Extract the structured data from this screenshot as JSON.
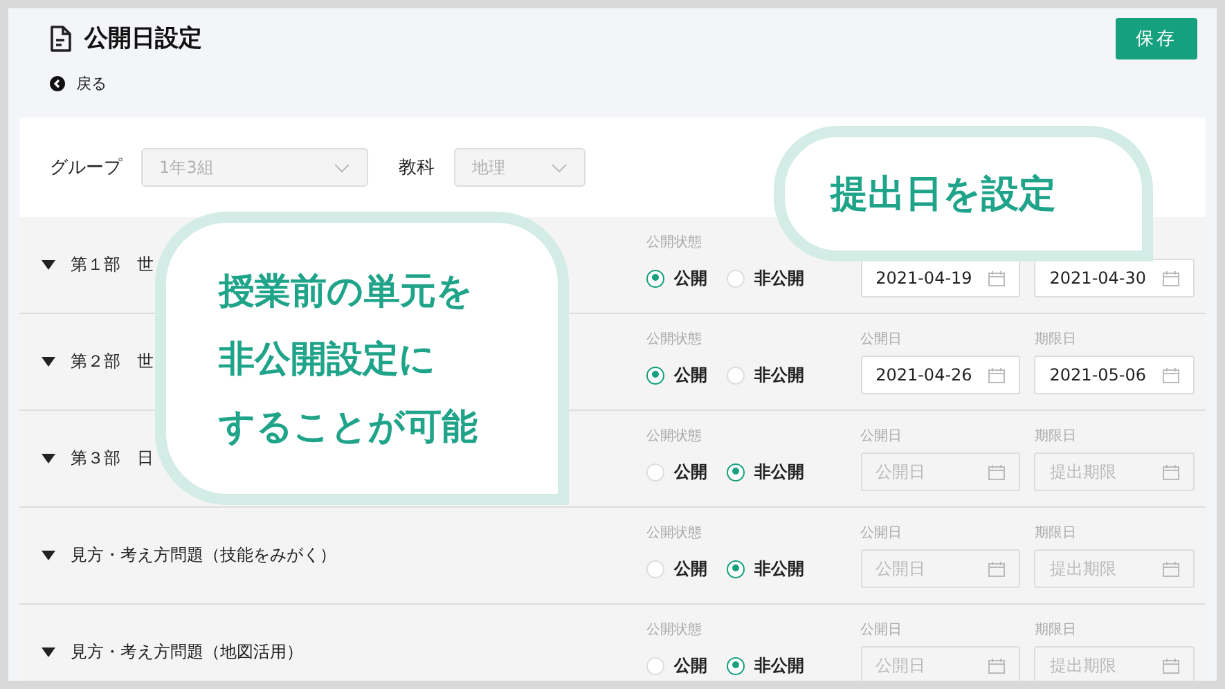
{
  "header": {
    "title": "公開日設定",
    "back": "戻る",
    "save_button": "保存"
  },
  "filters": [
    {
      "label": "グループ",
      "value": "1年3組",
      "disabled": true
    },
    {
      "label": "教科",
      "value": "地理",
      "disabled": true
    }
  ],
  "rows": [
    {
      "title": "第１部　世",
      "status_label": "公開状態",
      "options": [
        {
          "label": "公開",
          "selected": true
        },
        {
          "label": "非公開",
          "selected": false
        }
      ],
      "dates": [
        {
          "value": "2021-04-19"
        },
        {
          "value": "2021-04-30"
        }
      ]
    },
    {
      "title": "第２部　世",
      "status_label": "公開状態",
      "options": [
        {
          "label": "公開",
          "selected": true
        },
        {
          "label": "非公開",
          "selected": false
        }
      ],
      "dates": [
        {
          "label": "公開日",
          "value": "2021-04-26"
        },
        {
          "label": "期限日",
          "value": "2021-05-06"
        }
      ]
    },
    {
      "title": "第３部　日",
      "status_label": "公開状態",
      "options": [
        {
          "label": "公開",
          "selected": false
        },
        {
          "label": "非公開",
          "selected": true
        }
      ],
      "dates": [
        {
          "label": "公開日",
          "placeholder": "公開日"
        },
        {
          "label": "期限日",
          "placeholder": "提出期限"
        }
      ]
    },
    {
      "title": "見方・考え方問題（技能をみがく）",
      "status_label": "公開状態",
      "options": [
        {
          "label": "公開",
          "selected": false
        },
        {
          "label": "非公開",
          "selected": true
        }
      ],
      "dates": [
        {
          "label": "公開日",
          "placeholder": "公開日"
        },
        {
          "label": "期限日",
          "placeholder": "提出期限"
        }
      ]
    },
    {
      "title": "見方・考え方問題（地図活用）",
      "status_label": "公開状態",
      "options": [
        {
          "label": "公開",
          "selected": false
        },
        {
          "label": "非公開",
          "selected": true
        }
      ],
      "dates": [
        {
          "label": "公開日",
          "placeholder": "公開日"
        },
        {
          "label": "期限日",
          "placeholder": "提出期限"
        }
      ]
    }
  ],
  "callouts": [
    {
      "kind": "left",
      "lines": [
        "授業前の単元を",
        "非公開設定に",
        "することが可能"
      ]
    },
    {
      "kind": "right",
      "lines": [
        "提出日を設定"
      ]
    }
  ]
}
